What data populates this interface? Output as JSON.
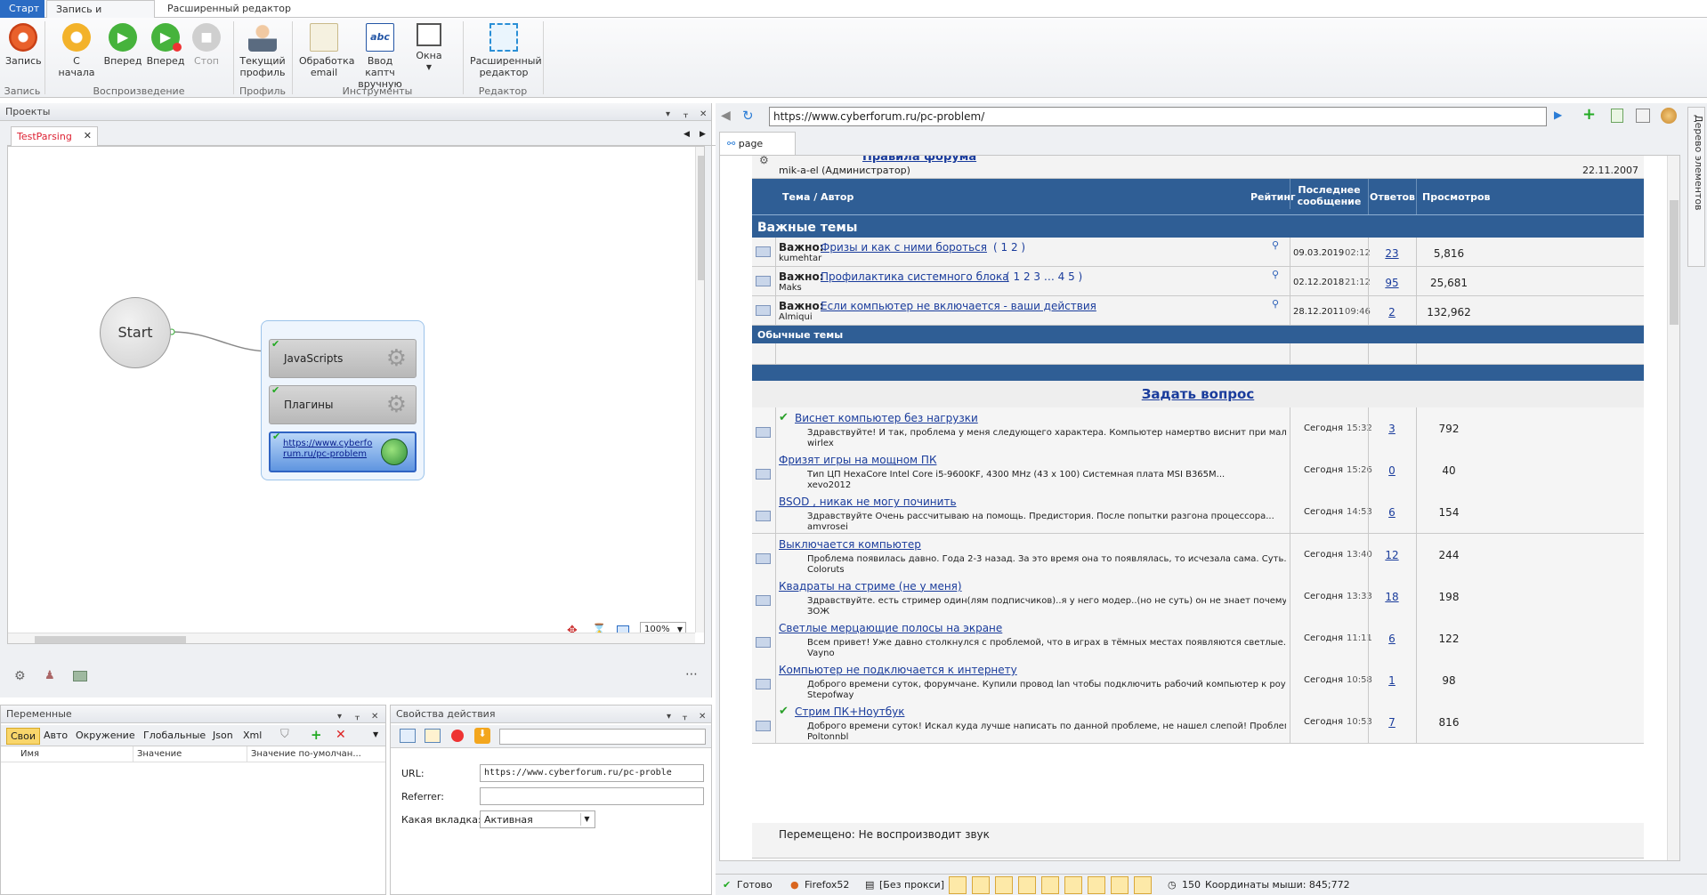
{
  "ribbon": {
    "tabs": [
      "Старт",
      "Запись и отладка",
      "Расширенный редактор"
    ],
    "buttons": {
      "record": "Запись",
      "from_start": "С начала",
      "forward": "Вперед",
      "forward2": "Вперед",
      "stop": "Стоп",
      "profile": "Текущий профиль",
      "email": "Обработка email",
      "captcha": "Ввод каптч вручную",
      "windows": "Окна",
      "editor": "Расширенный редактор"
    },
    "groups": {
      "record": "Запись",
      "playback": "Воспроизведение",
      "profile": "Профиль",
      "tools": "Инструменты",
      "editor": "Редактор"
    }
  },
  "projects": {
    "title": "Проекты",
    "tab": "TestParsing",
    "start": "Start",
    "node_js": "JavaScripts",
    "node_plugins": "Плагины",
    "node_url": "https://www.cyberforum.ru/pc-problem",
    "zoom": "100%"
  },
  "variables": {
    "title": "Переменные",
    "tabs": [
      "Свои",
      "Авто",
      "Окружение",
      "Глобальные",
      "Json",
      "Xml"
    ],
    "columns": [
      "Имя",
      "Значение",
      "Значение по-умолчан..."
    ]
  },
  "action": {
    "title": "Свойства действия",
    "url_label": "URL:",
    "url_value": "https://www.cyberforum.ru/pc-proble",
    "referrer_label": "Referrer:",
    "referrer_value": "",
    "tab_label": "Какая вкладка:",
    "tab_value": "Активная"
  },
  "browser": {
    "url": "https://www.cyberforum.ru/pc-problem/",
    "page_tab": "page",
    "side_tab": "Дерево элементов",
    "announce_title": "Правила форума",
    "announce_author": "mik-a-el (Администратор)",
    "announce_date": "22.11.2007",
    "headers": {
      "topic": "Тема / Автор",
      "rating": "Рейтинг",
      "last": "Последнее сообщение",
      "replies": "Ответов",
      "views": "Просмотров"
    },
    "important_title": "Важные темы",
    "normal_title": "Обычные темы",
    "ask": "Задать вопрос",
    "important": [
      {
        "prefix": "Важно:",
        "title": "Фризы и как с ними бороться",
        "pages": "( 1 2 )",
        "author": "kumehtar",
        "date": "09.03.2019",
        "time": "02:12",
        "replies": "23",
        "views": "5,816"
      },
      {
        "prefix": "Важно:",
        "title": "Профилактика системного блока",
        "pages": "( 1 2 3 … 4 5 )",
        "author": "Maks",
        "date": "02.12.2018",
        "time": "21:12",
        "replies": "95",
        "views": "25,681"
      },
      {
        "prefix": "Важно:",
        "title": "Если компьютер не включается - ваши действия",
        "pages": "",
        "author": "Almiqui",
        "date": "28.12.2011",
        "time": "09:46",
        "replies": "2",
        "views": "132,962"
      }
    ],
    "topics": [
      {
        "title": "Виснет компьютер без нагрузки",
        "snippet": "Здравствуйте! И так, проблема у меня следующего характера. Компьютер намертво виснит при малых...",
        "author": "wirlex",
        "date": "Сегодня",
        "time": "15:32",
        "replies": "3",
        "views": "792",
        "check": true
      },
      {
        "title": "Фризят игры на мощном ПК",
        "snippet": "Тип ЦП HexaCore Intel Core i5-9600KF, 4300 MHz (43 x 100) Системная плата MSI B365M...",
        "author": "xevo2012",
        "date": "Сегодня",
        "time": "15:26",
        "replies": "0",
        "views": "40",
        "check": false
      },
      {
        "title": "BSOD , никак не могу починить",
        "snippet": "Здравствуйте Очень рассчитываю на помощь. Предистория. После попытки разгона процессора...",
        "author": "amvrosei",
        "date": "Сегодня",
        "time": "14:53",
        "replies": "6",
        "views": "154",
        "check": false
      },
      {
        "title": "Выключается компьютер",
        "snippet": "Проблема появилась давно. Года 2-3 назад. За это время она то появлялась, то исчезала сама. Суть...",
        "author": "Coloruts",
        "date": "Сегодня",
        "time": "13:40",
        "replies": "12",
        "views": "244",
        "check": false
      },
      {
        "title": "Квадраты на стриме (не у меня)",
        "snippet": "Здравствуйте. есть стример один(лям подписчиков)..я у него модер..(но не суть) он не знает почему у...",
        "author": "ЗОЖ",
        "date": "Сегодня",
        "time": "13:33",
        "replies": "18",
        "views": "198",
        "check": false
      },
      {
        "title": "Светлые мерцающие полосы на экране",
        "snippet": "Всем привет! Уже давно столкнулся с проблемой, что в играх в тёмных местах появляются светлые...",
        "author": "Vayno",
        "date": "Сегодня",
        "time": "11:11",
        "replies": "6",
        "views": "122",
        "check": false
      },
      {
        "title": "Компьютер не подключается к интернету",
        "snippet": "Доброго времени суток, форумчане. Купили провод lan чтобы подключить рабочий компьютер к роутеру...",
        "author": "Stepofway",
        "date": "Сегодня",
        "time": "10:58",
        "replies": "1",
        "views": "98",
        "check": false
      },
      {
        "title": "Стрим ПК+Ноутбук",
        "snippet": "Доброго времени суток! Искал куда лучше написать по данной проблеме, не нашел слепой! Проблема...",
        "author": "Poltonnbl",
        "date": "Сегодня",
        "time": "10:53",
        "replies": "7",
        "views": "816",
        "check": true
      }
    ],
    "moved": "Перемещено: Не воспроизводит звук"
  },
  "status": {
    "ready": "Готово",
    "browser": "Firefox52",
    "proxy": "[Без прокси]",
    "threads": "150",
    "mouse": "Координаты мыши: 845;772"
  }
}
